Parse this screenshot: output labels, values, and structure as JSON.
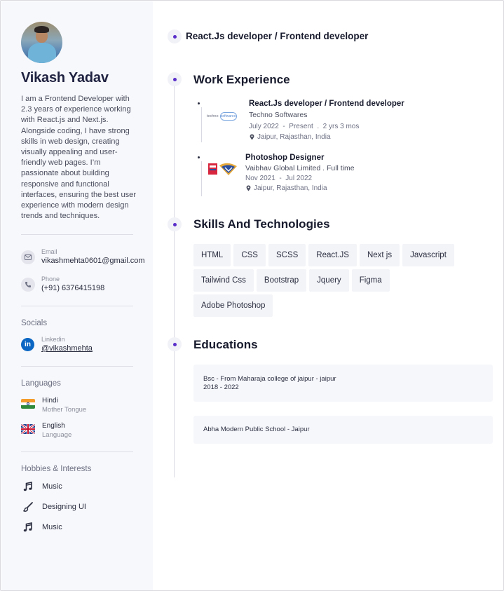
{
  "profile": {
    "name": "Vikash Yadav",
    "bio": "I am a Frontend Developer with 2.3 years of experience working with React.js and Next.js. Alongside coding, I have strong skills in web design, creating visually appealing and user-friendly web pages. I’m passionate about building responsive and functional interfaces, ensuring the best user experience with modern design trends and techniques."
  },
  "contact": {
    "email_label": "Email",
    "email_value": "vikashmehta0601@gmail.com",
    "phone_label": "Phone",
    "phone_value": "(+91) 6376415198"
  },
  "socials": {
    "heading": "Socials",
    "linkedin_label": "Linkedin",
    "linkedin_handle": "@vikashmehta",
    "icon_text": "in"
  },
  "languages": {
    "heading": "Languages",
    "items": [
      {
        "name": "Hindi",
        "level": "Mother Tongue"
      },
      {
        "name": "English",
        "level": "Language"
      }
    ]
  },
  "hobbies": {
    "heading": "Hobbies & Interests",
    "items": [
      "Music",
      "Designing UI",
      "Music"
    ]
  },
  "headline": "React.Js developer / Frontend developer",
  "work": {
    "heading": "Work Experience",
    "jobs": [
      {
        "title": "React.Js developer / Frontend developer",
        "company": "Techno Softwares",
        "start": "July 2022",
        "end": "Present",
        "duration": "2 yrs 3 mos",
        "location": "Jaipur, Rajasthan, India",
        "logo_text": "techno",
        "logo_ring": "softwares"
      },
      {
        "title": "Photoshop Designer",
        "company": "Vaibhav Global Limited . Full time",
        "start": "Nov 2021",
        "end": "Jul 2022",
        "location": "Jaipur, Rajasthan, India"
      }
    ],
    "date_sep": "-",
    "dur_sep": "."
  },
  "skills": {
    "heading": "Skills And Technologies",
    "items": [
      "HTML",
      "CSS",
      "SCSS",
      "React.JS",
      "Next js",
      "Javascript",
      "Tailwind Css",
      "Bootstrap",
      "Jquery",
      "Figma",
      "Adobe Photoshop"
    ]
  },
  "education": {
    "heading": "Educations",
    "items": [
      {
        "line1": "Bsc -  From Maharaja college of jaipur   - jaipur",
        "line2": "2018 - 2022"
      },
      {
        "line1": "Abha Modern Public School    - Jaipur",
        "line2": ""
      }
    ]
  },
  "colors": {
    "accent": "#5a2fc9",
    "sidebar_bg": "#f7f8fb",
    "linkedin": "#0a66c2"
  }
}
